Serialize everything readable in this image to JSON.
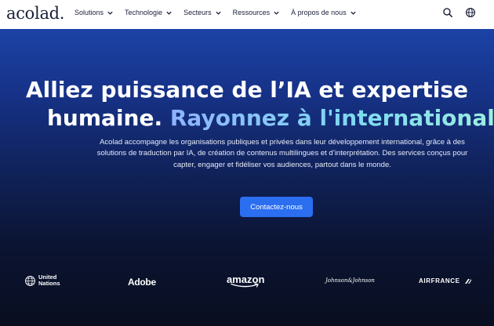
{
  "header": {
    "logo": "acolad.",
    "nav": [
      {
        "label": "Solutions"
      },
      {
        "label": "Technologie"
      },
      {
        "label": "Secteurs"
      },
      {
        "label": "Ressources"
      },
      {
        "label": "À propos de nous"
      }
    ],
    "icons": [
      "search-icon",
      "globe-icon"
    ]
  },
  "hero": {
    "headline_line1": "Alliez puissance de l’IA et expertise",
    "headline_line2_white": "humaine.",
    "headline_line2_accent": "Rayonnez à l'international.",
    "description": "Acolad accompagne les organisations publiques et privées dans leur développement international, grâce à des solutions de traduction par IA, de création de contenus multilingues et d’interprétation. Des services conçus pour capter, engager et fidéliser vos audiences, partout dans le monde.",
    "cta_label": "Contactez-nous"
  },
  "clients": {
    "un_line1": "United",
    "un_line2": "Nations",
    "adobe": "Adobe",
    "amazon": "amazon",
    "jnj": "Johnson&Johnson",
    "airfrance": "AIRFRANCE"
  },
  "colors": {
    "header_bg": "#ffffff",
    "text_dark": "#1a1f3a",
    "cta_bg": "#2b6ef0",
    "accent_start": "#8fb3ff",
    "accent_end": "#9ef0e0"
  }
}
